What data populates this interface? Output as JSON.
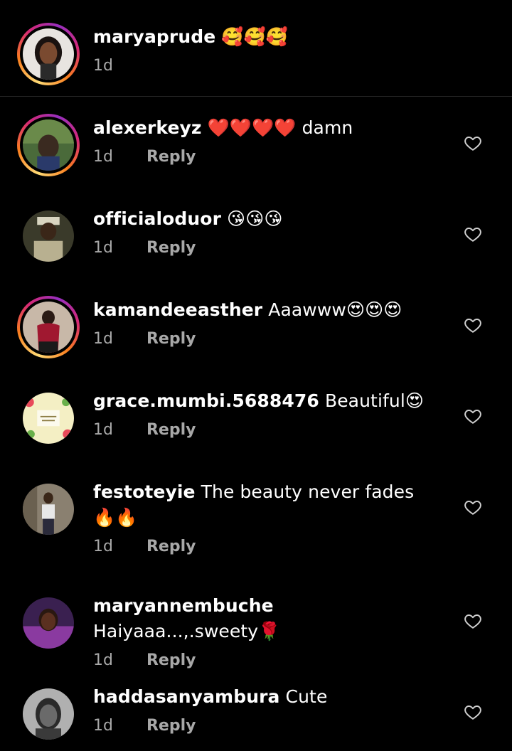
{
  "caption": {
    "username": "maryaprude",
    "text": "🥰🥰🥰",
    "time": "1d"
  },
  "reply_label": "Reply",
  "comments": [
    {
      "username": "alexerkeyz",
      "text": "❤️❤️❤️❤️ damn",
      "time": "1d",
      "avatar_color": "#3b5a2e"
    },
    {
      "username": "officialoduor",
      "text": "😘😘😘",
      "time": "1d",
      "avatar_color": "#4a4a38"
    },
    {
      "username": "kamandeeasther",
      "text": "Aaawww😍😍😍",
      "time": "1d",
      "avatar_color": "#6b1a2a"
    },
    {
      "username": "grace.mumbi.5688476",
      "text": "Beautiful😍",
      "time": "1d",
      "avatar_color": "#f5f0c8"
    },
    {
      "username": "festoteyie",
      "text": "The beauty never fades🔥🔥",
      "time": "1d",
      "avatar_color": "#7a7060"
    },
    {
      "username": "maryannembuche",
      "text": "Haiyaaa...,.sweety🌹",
      "time": "1d",
      "avatar_color": "#2a1a40"
    },
    {
      "username": "haddasanyambura",
      "text": "Cute",
      "time": "1d",
      "avatar_color": "#8a8a8a"
    }
  ]
}
